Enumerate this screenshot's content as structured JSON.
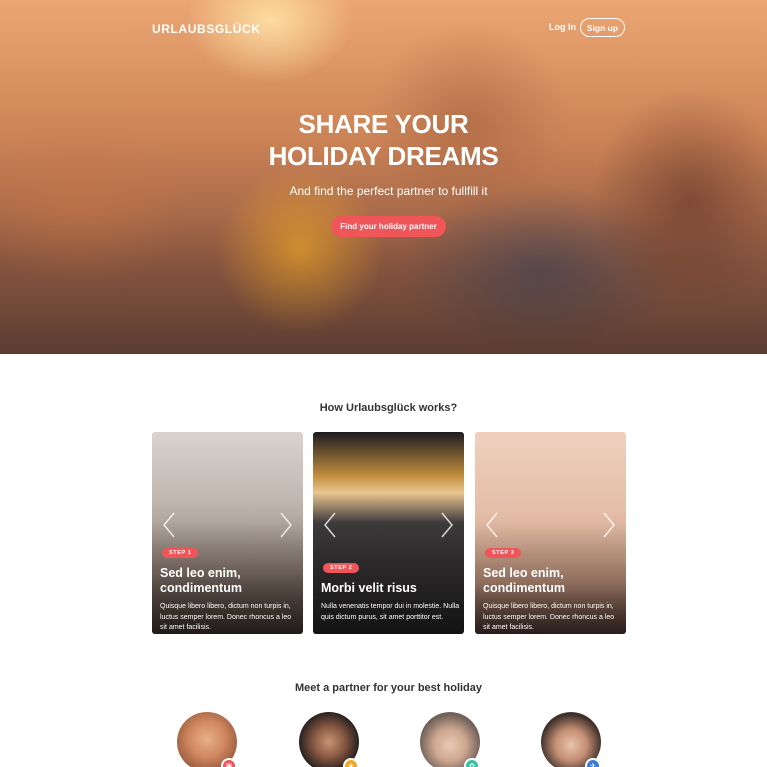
{
  "header": {
    "logo": "URLAUBSGLÜCK",
    "login_label": "Log In",
    "signup_label": "Sign up"
  },
  "hero": {
    "title_line1": "SHARE YOUR",
    "title_line2": "HOLIDAY DREAMS",
    "subtitle": "And find the perfect partner to fullfill it",
    "cta_label": "Find your holiday partner"
  },
  "how": {
    "title": "How Urlaubsglück works?",
    "cards": [
      {
        "step": "STEP 1",
        "title": "Sed leo enim, condimentum",
        "text": "Quisque libero libero, dictum non turpis in, luctus semper lorem. Donec rhoncus a leo sit amet facilisis."
      },
      {
        "step": "STEP 2",
        "title": "Morbi velit risus",
        "text": "Nulla venenatis tempor dui in molestie. Nulla quis dictum purus, sit amet porttitor est."
      },
      {
        "step": "STEP 3",
        "title": "Sed leo enim, condimentum",
        "text": "Quisque libero libero, dictum non turpis in, luctus semper lorem. Donec rhoncus a leo sit amet facilisis."
      }
    ]
  },
  "partners": {
    "title": "Meet a partner for your best holiday",
    "avatars": [
      {
        "badge_icon": "bag-icon",
        "badge_color": "#f0555a"
      },
      {
        "badge_icon": "star-icon",
        "badge_color": "#f5a623"
      },
      {
        "badge_icon": "leaf-icon",
        "badge_color": "#2ec4a6"
      },
      {
        "badge_icon": "plane-icon",
        "badge_color": "#3a7bd5"
      }
    ]
  },
  "colors": {
    "accent": "#f0555a"
  }
}
